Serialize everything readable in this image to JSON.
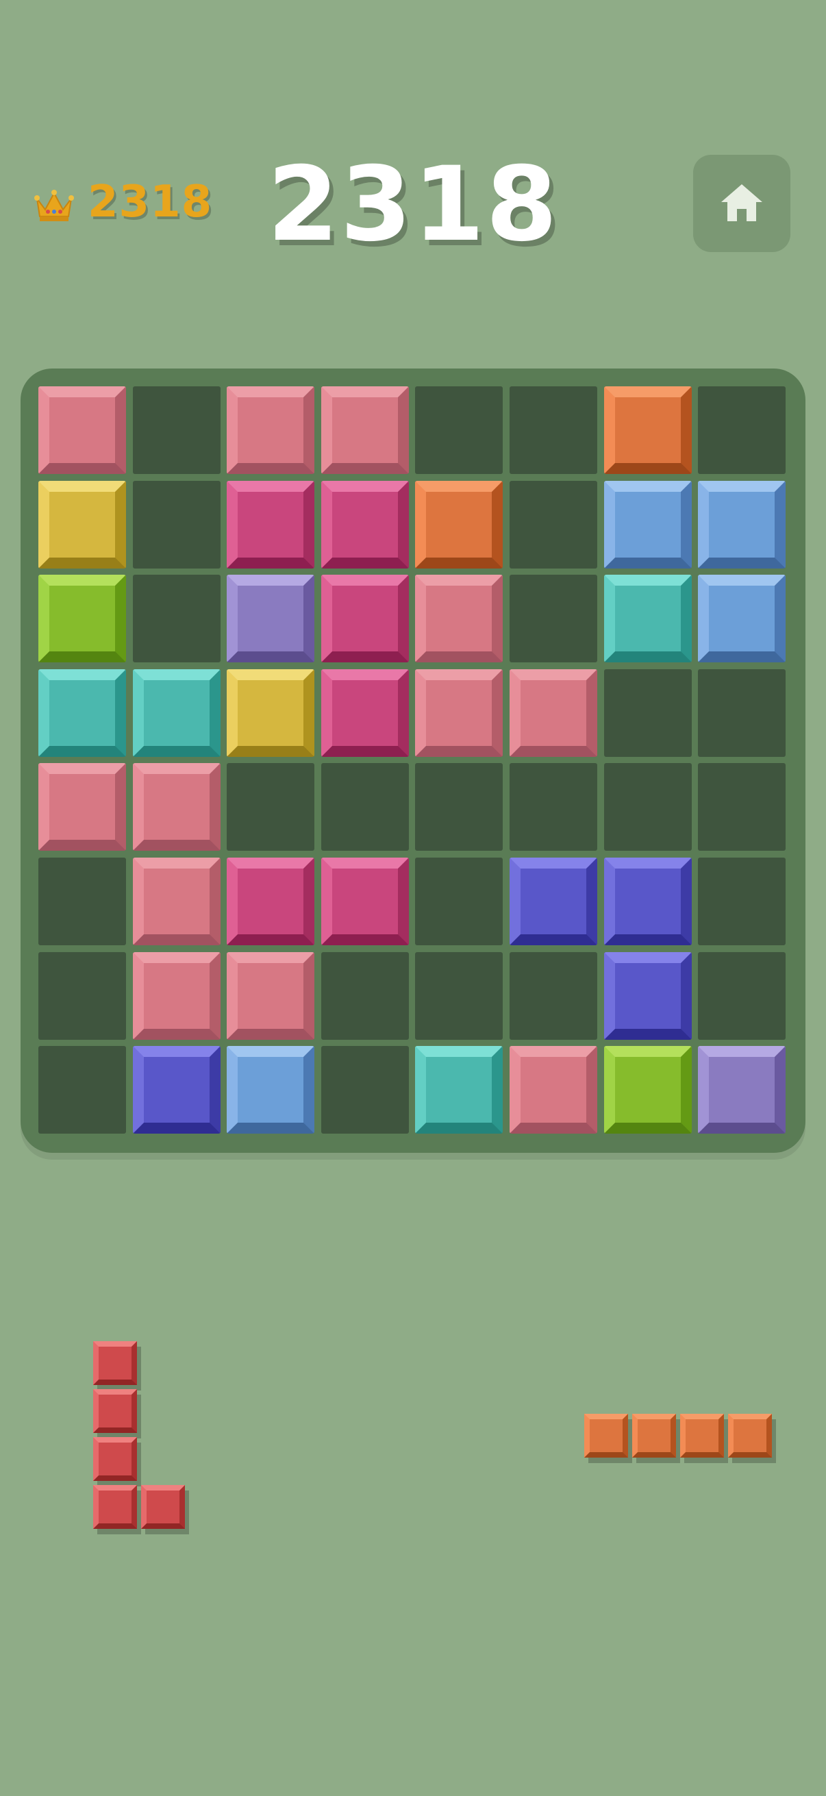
{
  "best": {
    "score": "2318",
    "icon": "crown"
  },
  "score": "2318",
  "home_button": {
    "icon": "home"
  },
  "board": {
    "rows": 8,
    "cols": 8,
    "cells": [
      [
        "pink",
        null,
        "pink",
        "pink",
        null,
        null,
        "orange",
        null
      ],
      [
        "yellow",
        null,
        "magenta",
        "magenta",
        "orange",
        null,
        "blue",
        "blue"
      ],
      [
        "green",
        null,
        "purple",
        "magenta",
        "pink",
        null,
        "teal",
        "blue"
      ],
      [
        "teal",
        "teal",
        "yellow",
        "magenta",
        "pink",
        "pink",
        null,
        null
      ],
      [
        "pink",
        "pink",
        null,
        null,
        null,
        null,
        null,
        null
      ],
      [
        null,
        "pink",
        "magenta",
        "magenta",
        null,
        "indigo",
        "indigo",
        null
      ],
      [
        null,
        "pink",
        "pink",
        null,
        null,
        null,
        "indigo",
        null
      ],
      [
        null,
        "indigo",
        "blue",
        null,
        "teal",
        "pink",
        "green",
        "purple"
      ]
    ]
  },
  "tray": [
    {
      "color": "red",
      "cells": [
        [
          0,
          0
        ],
        [
          1,
          0
        ],
        [
          2,
          0
        ],
        [
          3,
          0
        ],
        [
          3,
          1
        ]
      ]
    },
    {
      "color": "orange",
      "cells": [
        [
          0,
          0
        ],
        [
          0,
          1
        ],
        [
          0,
          2
        ],
        [
          0,
          3
        ]
      ]
    }
  ],
  "colors": {
    "pink": {
      "face": "#d77884",
      "top": "#ec9ea7",
      "left": "#e78e99",
      "right": "#b45d69",
      "bottom": "#a25260"
    },
    "orange": {
      "face": "#dd753f",
      "top": "#f69c68",
      "left": "#f38c55",
      "right": "#b4531f",
      "bottom": "#9d4719"
    },
    "yellow": {
      "face": "#d5b73f",
      "top": "#f1dc78",
      "left": "#ebcf5f",
      "right": "#af931f",
      "bottom": "#987f18"
    },
    "magenta": {
      "face": "#c9467d",
      "top": "#e978a8",
      "left": "#df6094",
      "right": "#a42d5f",
      "bottom": "#8e1f50"
    },
    "blue": {
      "face": "#6c9fd8",
      "top": "#a0c6f0",
      "left": "#89b4e8",
      "right": "#4c79b3",
      "bottom": "#3f689d"
    },
    "green": {
      "face": "#86bc2c",
      "top": "#b4e05c",
      "left": "#a0d446",
      "right": "#649a14",
      "bottom": "#548510"
    },
    "purple": {
      "face": "#8a7bc0",
      "top": "#b5a9e3",
      "left": "#a193d5",
      "right": "#6a5aa0",
      "bottom": "#5c4d8e"
    },
    "teal": {
      "face": "#4bb8ae",
      "top": "#7ee0d6",
      "left": "#63cfc4",
      "right": "#2b968c",
      "bottom": "#23847b"
    },
    "indigo": {
      "face": "#5957c9",
      "top": "#8583ea",
      "left": "#7270dd",
      "right": "#3d3ba6",
      "bottom": "#2f2d92"
    },
    "red": {
      "face": "#cf4a4c",
      "top": "#ef8180",
      "left": "#e66a6b",
      "right": "#a8302f",
      "bottom": "#922625"
    }
  }
}
